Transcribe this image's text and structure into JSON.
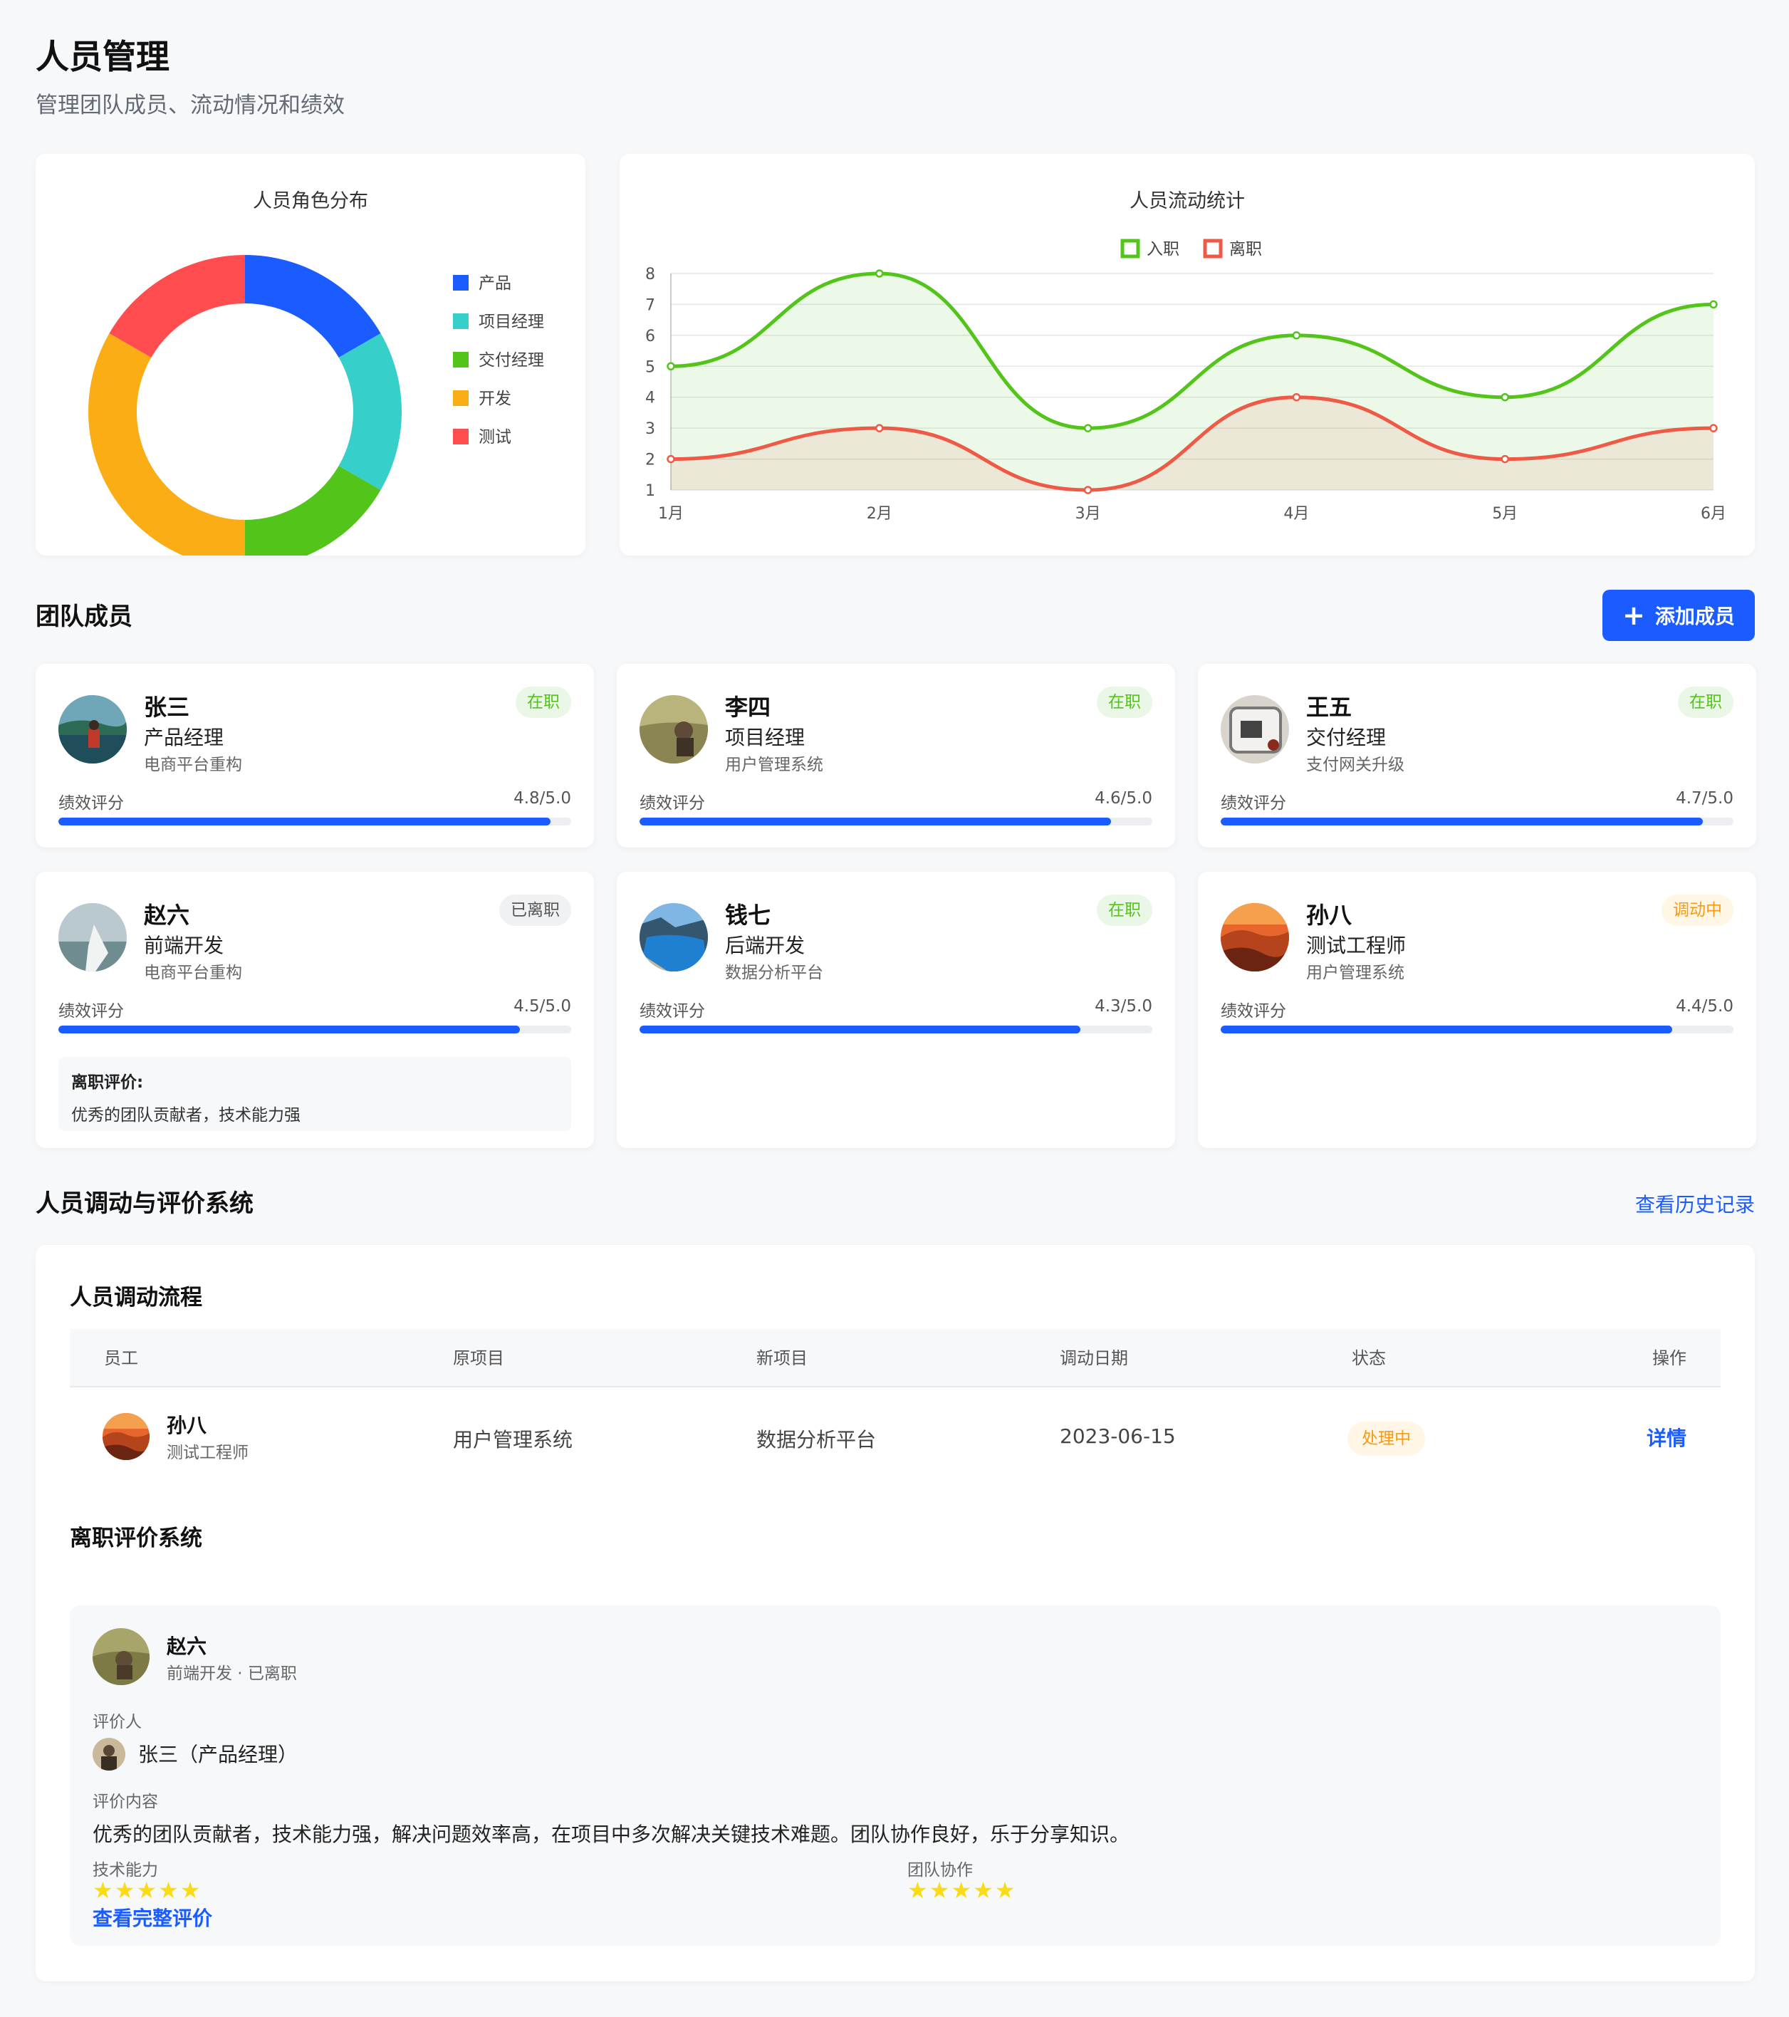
{
  "header": {
    "title": "人员管理",
    "subtitle": "管理团队成员、流动情况和绩效"
  },
  "colors": {
    "primary": "#1a5cff",
    "product": "#1a5cff",
    "project_manager": "#36cfc9",
    "delivery_manager": "#52c41a",
    "development": "#faad14",
    "testing": "#ff4d4f",
    "onboard_line": "#52c41a",
    "leave_line": "#ee5a45"
  },
  "chart_data": [
    {
      "type": "pie",
      "title": "人员角色分布",
      "legend_position": "right",
      "labels": [
        "产品",
        "项目经理",
        "交付经理",
        "开发",
        "测试"
      ],
      "values": [
        15,
        15,
        15,
        30,
        15
      ]
    },
    {
      "type": "line",
      "title": "人员流动统计",
      "legend_position": "top",
      "x": [
        "1月",
        "2月",
        "3月",
        "4月",
        "5月",
        "6月"
      ],
      "series": [
        {
          "name": "入职",
          "values": [
            5,
            8,
            3,
            6,
            4,
            7
          ]
        },
        {
          "name": "离职",
          "values": [
            2,
            3,
            1,
            4,
            2,
            3
          ]
        }
      ],
      "yticks": [
        1,
        2,
        3,
        4,
        5,
        6,
        7,
        8
      ],
      "ylim": [
        1,
        8
      ],
      "grid": true,
      "smooth": true,
      "area": true
    }
  ],
  "team": {
    "heading": "团队成员",
    "add_button": "添加成员",
    "add_icon": "plus-icon",
    "perf_label": "绩效评分",
    "members": [
      {
        "name": "张三",
        "role": "产品经理",
        "project": "电商平台重构",
        "status": "在职",
        "score_text": "4.8/5.0",
        "score": 4.8,
        "avatar_icon": "avatar-lake-photo"
      },
      {
        "name": "李四",
        "role": "项目经理",
        "project": "用户管理系统",
        "status": "在职",
        "score_text": "4.6/5.0",
        "score": 4.6,
        "avatar_icon": "avatar-field-photo"
      },
      {
        "name": "王五",
        "role": "交付经理",
        "project": "支付网关升级",
        "status": "在职",
        "score_text": "4.7/5.0",
        "score": 4.7,
        "avatar_icon": "avatar-car-photo"
      },
      {
        "name": "赵六",
        "role": "前端开发",
        "project": "电商平台重构",
        "status": "已离职",
        "score_text": "4.5/5.0",
        "score": 4.5,
        "avatar_icon": "avatar-sea-photo",
        "leave_title": "离职评价:",
        "leave_text": "优秀的团队贡献者，技术能力强"
      },
      {
        "name": "钱七",
        "role": "后端开发",
        "project": "数据分析平台",
        "status": "在职",
        "score_text": "4.3/5.0",
        "score": 4.3,
        "avatar_icon": "avatar-fjord-photo"
      },
      {
        "name": "孙八",
        "role": "测试工程师",
        "project": "用户管理系统",
        "status": "调动中",
        "score_text": "4.4/5.0",
        "score": 4.4,
        "avatar_icon": "avatar-canyon-photo"
      }
    ]
  },
  "system": {
    "heading": "人员调动与评价系统",
    "history_link": "查看历史记录",
    "transfer": {
      "heading": "人员调动流程",
      "columns": [
        "员工",
        "原项目",
        "新项目",
        "调动日期",
        "状态",
        "操作"
      ],
      "rows": [
        {
          "name": "孙八",
          "role": "测试工程师",
          "from": "用户管理系统",
          "to": "数据分析平台",
          "date": "2023-06-15",
          "status": "处理中",
          "action": "详情"
        }
      ]
    },
    "evaluation": {
      "heading": "离职评价系统",
      "name": "赵六",
      "sub": "前端开发 · 已离职",
      "evaluator_label": "评价人",
      "evaluator": "张三（产品经理）",
      "content_label": "评价内容",
      "content": "优秀的团队贡献者，技术能力强，解决问题效率高，在项目中多次解决关键技术难题。团队协作良好，乐于分享知识。",
      "tech_label": "技术能力",
      "tech_stars": 5,
      "team_label": "团队协作",
      "team_stars": 5,
      "full_link": "查看完整评价"
    }
  }
}
